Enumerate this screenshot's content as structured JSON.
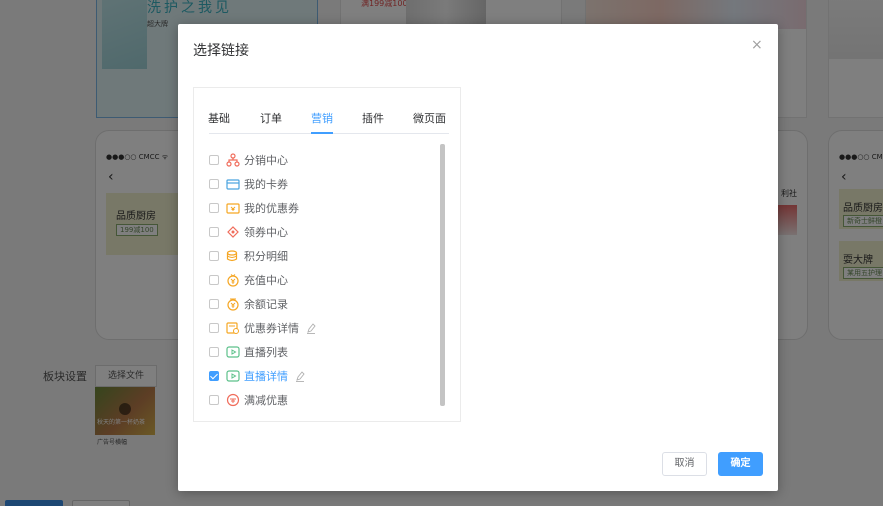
{
  "background": {
    "banner_headline": "洗护之我见",
    "banner_sub": "超大牌",
    "promo_text": "满199减100",
    "phone_status": "●●●○○ CMCC ᯤ",
    "phone_status_right": "●●●○○ CMCC",
    "card1_title": "品质厨房",
    "card1_tag": "199减100",
    "card2_title": "品质厨房",
    "card2_tag": "新奇士鲜橙",
    "card3_title": "耍大牌",
    "card3_tag": "某用五护理",
    "side_snippet": "利社",
    "module_label": "板块设置",
    "file_button": "选择文件",
    "file_caption": "广告号横幅",
    "file_overlay_text": "秋天的第一杯奶茶"
  },
  "modal": {
    "title": "选择链接",
    "close_glyph": "×",
    "tabs": [
      {
        "label": "基础"
      },
      {
        "label": "订单"
      },
      {
        "label": "营销"
      },
      {
        "label": "插件"
      },
      {
        "label": "微页面"
      }
    ],
    "active_tab": "营销",
    "items": [
      {
        "label": "分销中心",
        "icon": "distribution-icon",
        "checked": false
      },
      {
        "label": "我的卡券",
        "icon": "card-icon",
        "checked": false
      },
      {
        "label": "我的优惠券",
        "icon": "coupon-icon",
        "checked": false
      },
      {
        "label": "领券中心",
        "icon": "coupon-center-icon",
        "checked": false
      },
      {
        "label": "积分明细",
        "icon": "points-icon",
        "checked": false
      },
      {
        "label": "充值中心",
        "icon": "recharge-icon",
        "checked": false
      },
      {
        "label": "余额记录",
        "icon": "balance-icon",
        "checked": false
      },
      {
        "label": "优惠券详情",
        "icon": "coupon-detail-icon",
        "checked": false,
        "editable": true
      },
      {
        "label": "直播列表",
        "icon": "live-list-icon",
        "checked": false
      },
      {
        "label": "直播详情",
        "icon": "live-detail-icon",
        "checked": true,
        "editable": true
      },
      {
        "label": "满减优惠",
        "icon": "discount-icon",
        "checked": false
      }
    ],
    "cancel_label": "取消",
    "confirm_label": "确定"
  },
  "colors": {
    "primary": "#409eff",
    "overlay": "rgba(0,0,0,0.5)",
    "icon_orange": "#f5a623",
    "icon_blue": "#4aa3df",
    "icon_red": "#f06c5b",
    "icon_green": "#5cc08a"
  }
}
